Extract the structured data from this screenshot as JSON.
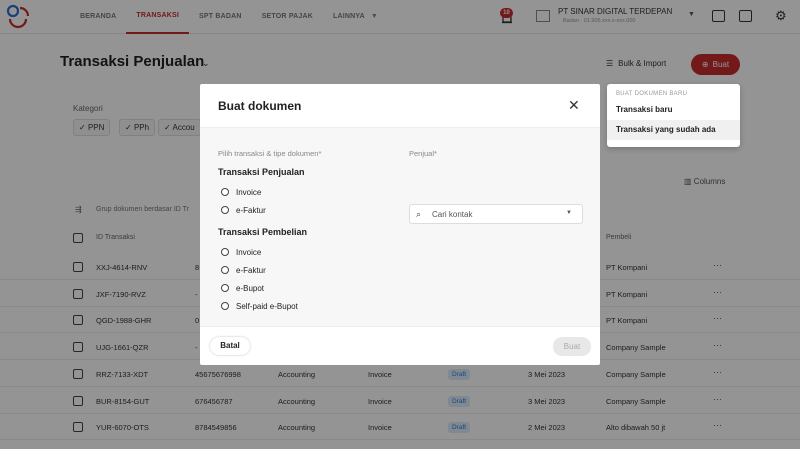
{
  "nav": {
    "items": [
      "BERANDA",
      "TRANSAKSI",
      "SPT BADAN",
      "SETOR PAJAK",
      "LAINNYA"
    ],
    "notification_count": "10",
    "company_name": "PT SINAR DIGITAL TERDEPAN",
    "company_sub": "Badan · 01.905.xxx.x-xxx.000",
    "accent": "#c62b2b"
  },
  "page": {
    "title": "Transaksi Penjualan",
    "bulk_label": "Bulk & Import",
    "buat_label": "Buat"
  },
  "dropdown": {
    "header": "BUAT DOKUMEN BARU",
    "items": [
      "Transaksi baru",
      "Transaksi yang sudah ada"
    ]
  },
  "background": {
    "kategori_label": "Kategori",
    "chips": [
      "PPN",
      "PPh",
      "Accou"
    ],
    "columns_label": "Columns",
    "group_label": "Grup dokumen berdasar ID Tr",
    "headers": {
      "id": "ID Transaksi",
      "buyer": "Pembeli"
    },
    "rows": [
      {
        "id": "XXJ-4614-RNV",
        "num": "8",
        "cat": "",
        "type": "",
        "status": "",
        "date": "",
        "buyer": "PT Kompani"
      },
      {
        "id": "JXF-7190-RVZ",
        "num": "-",
        "cat": "",
        "type": "",
        "status": "",
        "date": "",
        "buyer": "PT Kompani"
      },
      {
        "id": "QGD-1988-GHR",
        "num": "0",
        "cat": "",
        "type": "",
        "status": "",
        "date": "",
        "buyer": "PT Kompani"
      },
      {
        "id": "UJG-1661-QZR",
        "num": "-",
        "cat": "",
        "type": "",
        "status": "",
        "date": "",
        "buyer": "Company Sample"
      },
      {
        "id": "RRZ-7133-XDT",
        "num": "45675676998",
        "cat": "Accounting",
        "type": "Invoice",
        "status": "Draft",
        "date": "3 Mei 2023",
        "buyer": "Company Sample"
      },
      {
        "id": "BUR-8154-GUT",
        "num": "676456787",
        "cat": "Accounting",
        "type": "Invoice",
        "status": "Draft",
        "date": "3 Mei 2023",
        "buyer": "Company Sample"
      },
      {
        "id": "YUR-6070-OTS",
        "num": "8784549856",
        "cat": "Accounting",
        "type": "Invoice",
        "status": "Draft",
        "date": "2 Mei 2023",
        "buyer": "Alto dibawah 50 jt"
      }
    ]
  },
  "modal": {
    "title": "Buat dokumen",
    "left_label": "Pilih transaksi & tipe dokumen*",
    "seller_label": "Penjual*",
    "seller_placeholder": "Cari kontak",
    "penjualan_title": "Transaksi Penjualan",
    "penjualan_options": [
      "Invoice",
      "e-Faktur"
    ],
    "pembelian_title": "Transaksi Pembelian",
    "pembelian_options": [
      "Invoice",
      "e-Faktur",
      "e-Bupot",
      "Self-paid e-Bupot"
    ],
    "cancel_label": "Batal",
    "submit_label": "Buat"
  }
}
